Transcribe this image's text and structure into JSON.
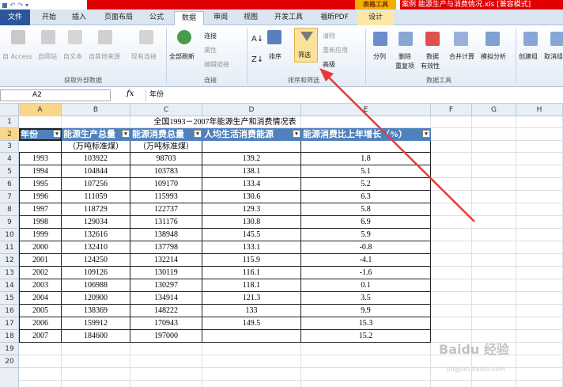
{
  "window": {
    "title": "案例 能源生产与消费情况.xls [兼容模式]",
    "tool_tag": "表格工具"
  },
  "tabs": [
    "文件",
    "开始",
    "插入",
    "页面布局",
    "公式",
    "数据",
    "审阅",
    "视图",
    "开发工具",
    "福昕PDF",
    "设计"
  ],
  "ribbon": {
    "get_external": {
      "access": "自 Access",
      "web": "自网站",
      "text": "自文本",
      "other": "自其他来源",
      "existing": "现有连接",
      "group": "获取外部数据"
    },
    "connections": {
      "refresh": "全部刷新",
      "connections": "连接",
      "properties": "属性",
      "edit_links": "编辑链接",
      "group": "连接"
    },
    "sort_filter": {
      "sort": "排序",
      "filter": "筛选",
      "clear": "清除",
      "reapply": "重新应用",
      "advanced": "高级",
      "group": "排序和筛选"
    },
    "data_tools": {
      "split": "分列",
      "remove_dup": "删除",
      "remove_dup2": "重复项",
      "validation": "数据",
      "validation2": "有效性",
      "consolidate": "合并计算",
      "what_if": "模拟分析",
      "group": "数据工具"
    },
    "outline": {
      "group_btn": "创建组",
      "ungroup": "取消组"
    }
  },
  "namebox": "A2",
  "fx": "fx",
  "formula": "年份",
  "columns": [
    "A",
    "B",
    "C",
    "D",
    "E",
    "F",
    "G",
    "H"
  ],
  "rows": [
    "1",
    "2",
    "3",
    "4",
    "5",
    "6",
    "7",
    "8",
    "9",
    "10",
    "11",
    "12",
    "13",
    "14",
    "15",
    "16",
    "17",
    "18",
    "19",
    "20"
  ],
  "sheet": {
    "title": "全国1993－2007年能源生产和消费情况表",
    "headers": [
      "年份",
      "能源生产总量",
      "能源消费总量",
      "人均生活消费能源",
      "能源消费比上年增长（%）"
    ],
    "subheaders": [
      "",
      "（万吨标准煤）",
      "（万吨标准煤）",
      "",
      ""
    ],
    "data": [
      [
        "1993",
        "103922",
        "98703",
        "139.2",
        "1.8"
      ],
      [
        "1994",
        "104844",
        "103783",
        "138.1",
        "5.1"
      ],
      [
        "1995",
        "107256",
        "109170",
        "133.4",
        "5.2"
      ],
      [
        "1996",
        "111059",
        "115993",
        "130.6",
        "6.3"
      ],
      [
        "1997",
        "118729",
        "122737",
        "129.3",
        "5.8"
      ],
      [
        "1998",
        "129034",
        "131176",
        "130.8",
        "6.9"
      ],
      [
        "1999",
        "132616",
        "138948",
        "145.5",
        "5.9"
      ],
      [
        "2000",
        "132410",
        "137798",
        "133.1",
        "-0.8"
      ],
      [
        "2001",
        "124250",
        "132214",
        "115.9",
        "-4.1"
      ],
      [
        "2002",
        "109126",
        "130119",
        "116.1",
        "-1.6"
      ],
      [
        "2003",
        "106988",
        "130297",
        "118.1",
        "0.1"
      ],
      [
        "2004",
        "120900",
        "134914",
        "121.3",
        "3.5"
      ],
      [
        "2005",
        "138369",
        "148222",
        "133",
        "9.9"
      ],
      [
        "2006",
        "159912",
        "170943",
        "149.5",
        "15.3"
      ],
      [
        "2007",
        "184600",
        "197000",
        "",
        "15.2"
      ]
    ]
  },
  "watermark": {
    "brand": "Baidu 经验",
    "url": "jingyan.baidu.com"
  }
}
